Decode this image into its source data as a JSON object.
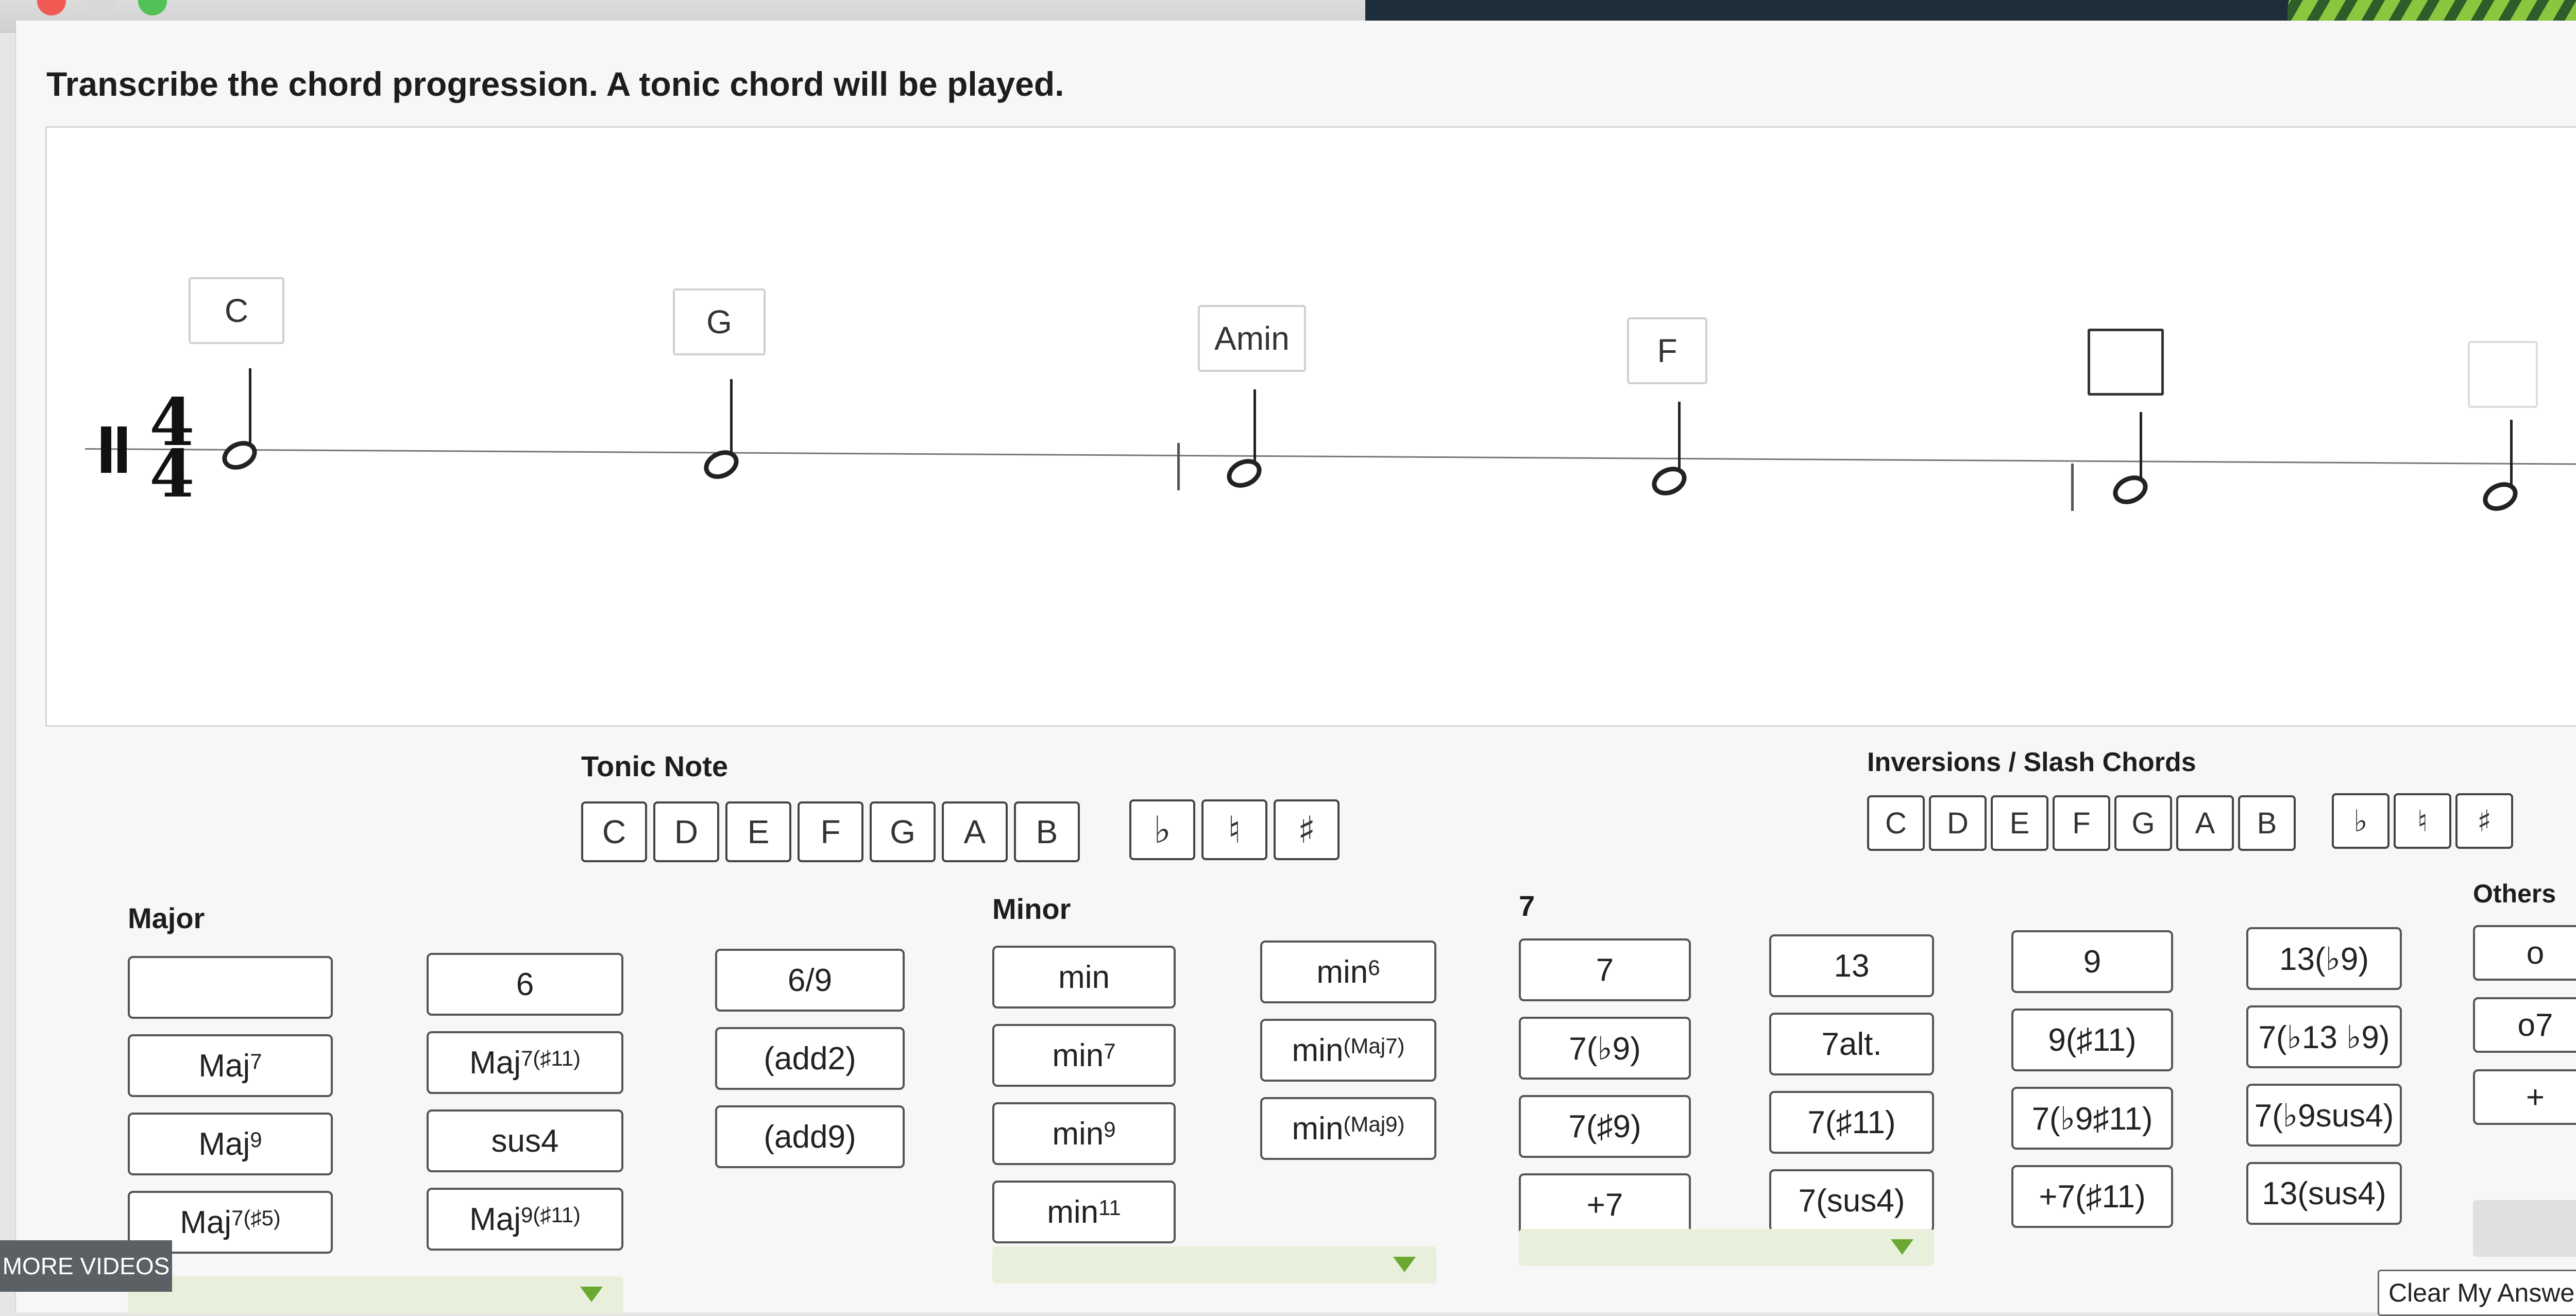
{
  "instruction": "Transcribe the chord progression.  A tonic chord will be played.",
  "staff": {
    "time_signature": {
      "top": "4",
      "bottom": "4"
    },
    "chords": [
      "C",
      "G",
      "Amin",
      "F",
      "",
      ""
    ]
  },
  "tonic_note": {
    "label": "Tonic Note",
    "notes": [
      "C",
      "D",
      "E",
      "F",
      "G",
      "A",
      "B"
    ],
    "accidentals": [
      "♭",
      "♮",
      "♯"
    ]
  },
  "inversions": {
    "label": "Inversions / Slash Chords",
    "notes": [
      "C",
      "D",
      "E",
      "F",
      "G",
      "A",
      "B"
    ],
    "accidentals": [
      "♭",
      "♮",
      "♯"
    ]
  },
  "qualities": {
    "major": {
      "label": "Major",
      "col1": [
        "",
        "Maj",
        "Maj",
        "Maj"
      ],
      "col1_sup": [
        "",
        "7",
        "9",
        "7(♯5)"
      ],
      "col2": [
        "6",
        "Maj",
        "sus4",
        "Maj"
      ],
      "col2_sup": [
        "",
        "7(♯11)",
        "",
        "9(♯11)"
      ],
      "col3": [
        "6/9",
        "(add2)",
        "(add9)"
      ]
    },
    "minor": {
      "label": "Minor",
      "col1": [
        "min",
        "min",
        "min",
        "min"
      ],
      "col1_sup": [
        "",
        "7",
        "9",
        "11"
      ],
      "col2": [
        "min",
        "min",
        "min"
      ],
      "col2_sup": [
        "6",
        "(Maj7)",
        "(Maj9)"
      ]
    },
    "seventh": {
      "label": "7",
      "col1": [
        "7",
        "7(♭9)",
        "7(♯9)",
        "+7"
      ],
      "col2": [
        "13",
        "7alt.",
        "7(♯11)",
        "7(sus4)"
      ],
      "col3": [
        "9",
        "9(♯11)",
        "7(♭9♯11)",
        "+7(♯11)"
      ],
      "col4": [
        "13(♭9)",
        "7(♭13 ♭9)",
        "7(♭9sus4)",
        "13(sus4)"
      ]
    },
    "others": {
      "label": "Others",
      "items": [
        "o",
        "o7",
        "+"
      ]
    }
  },
  "more_videos": "MORE VIDEOS",
  "clear_answer": "Clear My Answer",
  "colors": {
    "accent_green": "#6aa832",
    "dark_header": "#1d2e3a"
  }
}
